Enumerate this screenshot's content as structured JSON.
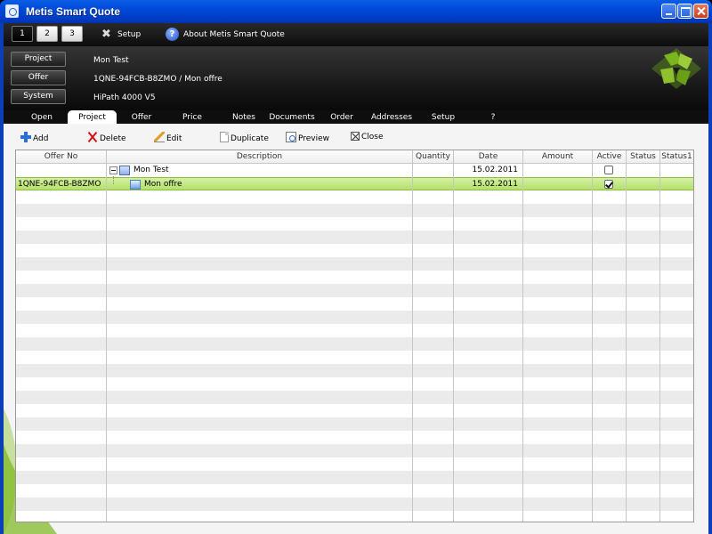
{
  "window": {
    "title": "Metis Smart Quote"
  },
  "topbar": {
    "numbers": [
      "1",
      "2",
      "3"
    ],
    "setup_label": "Setup",
    "about_label": "About Metis Smart Quote"
  },
  "header": {
    "buttons": [
      "Project",
      "Offer",
      "System"
    ],
    "values": [
      "Mon Test",
      "1QNE-94FCB-B8ZMO / Mon offre",
      "HiPath 4000 V5"
    ]
  },
  "tabs": [
    "Open",
    "Project",
    "Offer",
    "Price",
    "Notes",
    "Documents",
    "Order",
    "Addresses",
    "Setup",
    "?"
  ],
  "active_tab": "Project",
  "actions": {
    "add": "Add",
    "delete": "Delete",
    "edit": "Edit",
    "duplicate": "Duplicate",
    "preview": "Preview",
    "close": "Close"
  },
  "grid": {
    "columns": [
      "Offer No",
      "Description",
      "Quantity",
      "Date",
      "Amount",
      "Active",
      "Status",
      "Status1"
    ],
    "rows": [
      {
        "offer_no": "",
        "description": "Mon Test",
        "quantity": "",
        "date": "15.02.2011",
        "amount": "",
        "active": false
      },
      {
        "offer_no": "1QNE-94FCB-B8ZMO",
        "description": "Mon offre",
        "quantity": "",
        "date": "15.02.2011",
        "amount": "",
        "active": true,
        "selected": true
      }
    ]
  },
  "colors": {
    "selection": "#b4e06a",
    "titlebar": "#0048d8",
    "accent_green": "#7ab51d"
  }
}
